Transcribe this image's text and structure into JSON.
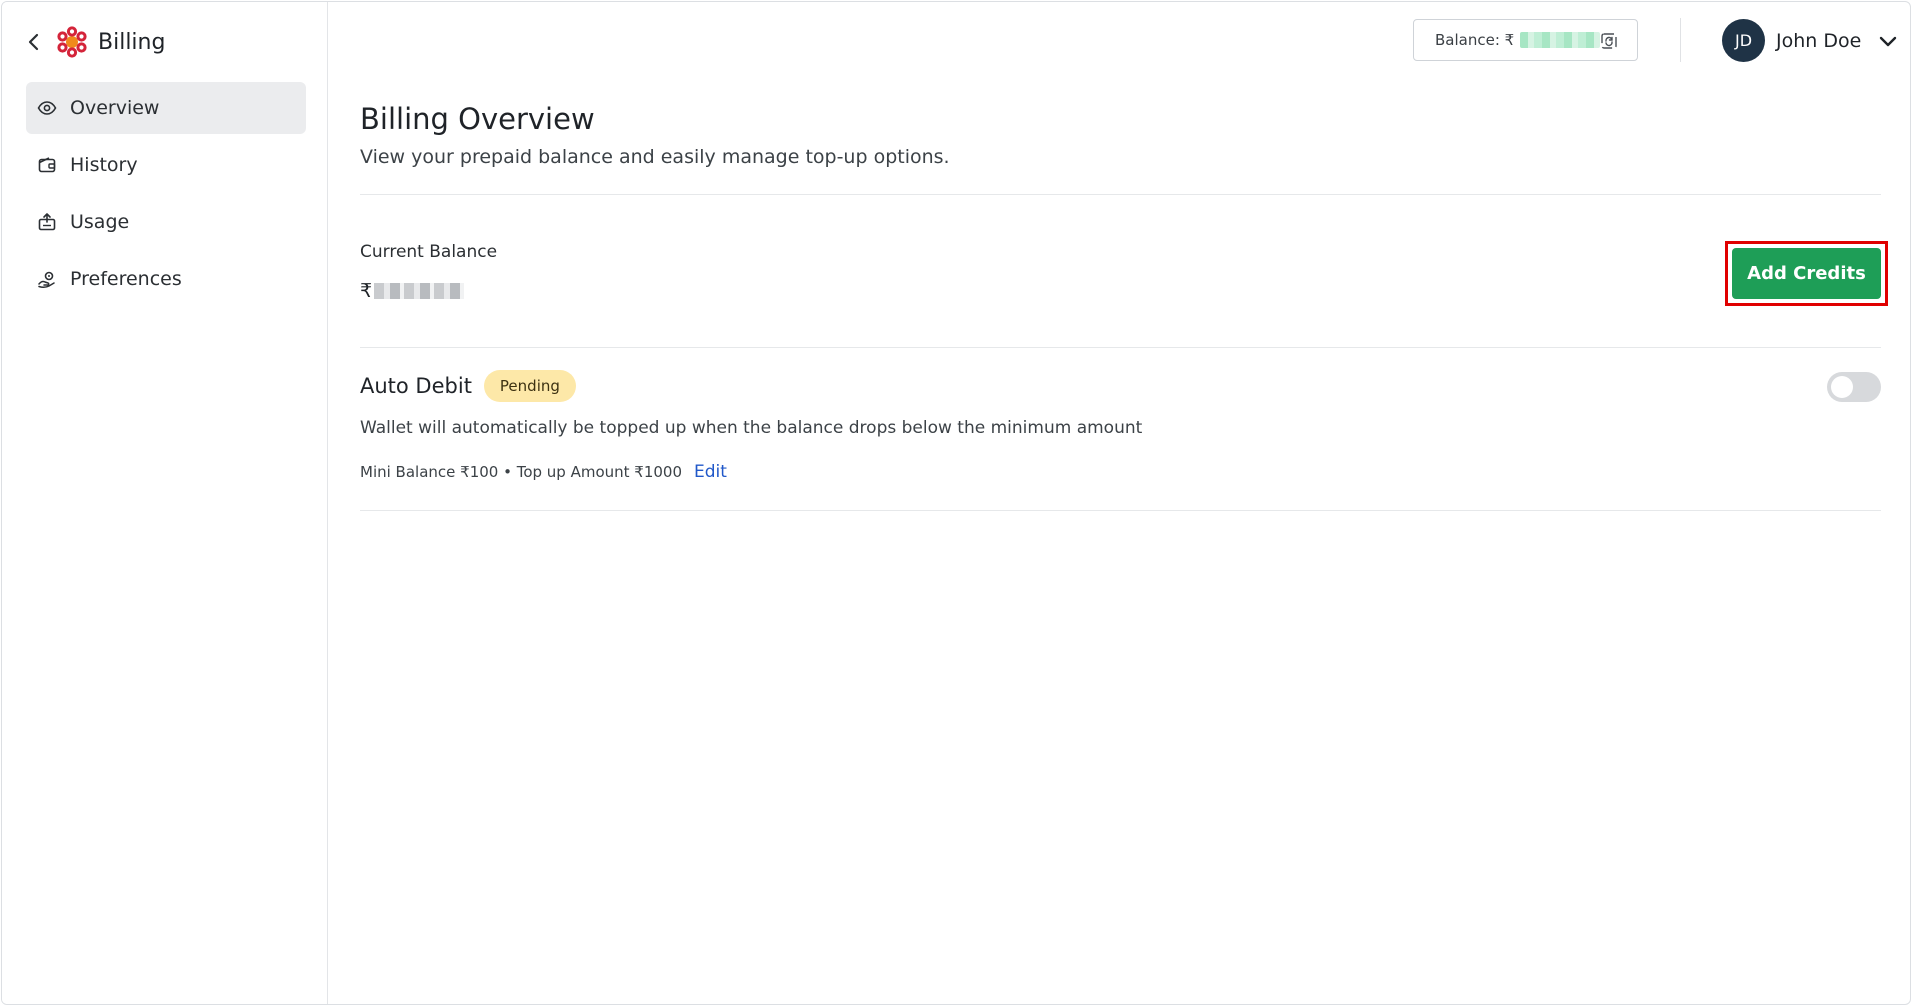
{
  "app": {
    "title": "Billing"
  },
  "sidebar": {
    "items": [
      {
        "label": "Overview",
        "icon": "eye-icon",
        "active": true
      },
      {
        "label": "History",
        "icon": "wallet-icon",
        "active": false
      },
      {
        "label": "Usage",
        "icon": "usage-icon",
        "active": false
      },
      {
        "label": "Preferences",
        "icon": "preferences-icon",
        "active": false
      }
    ]
  },
  "header": {
    "balance_label": "Balance: ₹",
    "user_initials": "JD",
    "user_name": "John Doe"
  },
  "main": {
    "title": "Billing Overview",
    "subtitle": "View your prepaid balance and easily manage top-up options.",
    "current_balance_label": "Current Balance",
    "current_balance_currency": "₹",
    "add_credits_label": "Add Credits",
    "auto_debit": {
      "title": "Auto Debit",
      "status": "Pending",
      "description": "Wallet will automatically be topped up when the balance drops below the minimum amount",
      "meta": "Mini Balance ₹100 • Top up Amount ₹1000",
      "edit_label": "Edit",
      "enabled": false
    }
  },
  "colors": {
    "accent_green": "#1e9e57",
    "badge_yellow": "#fde8a8",
    "link_blue": "#2158c9",
    "highlight_red": "#e00000",
    "avatar_bg": "#1f3346"
  }
}
